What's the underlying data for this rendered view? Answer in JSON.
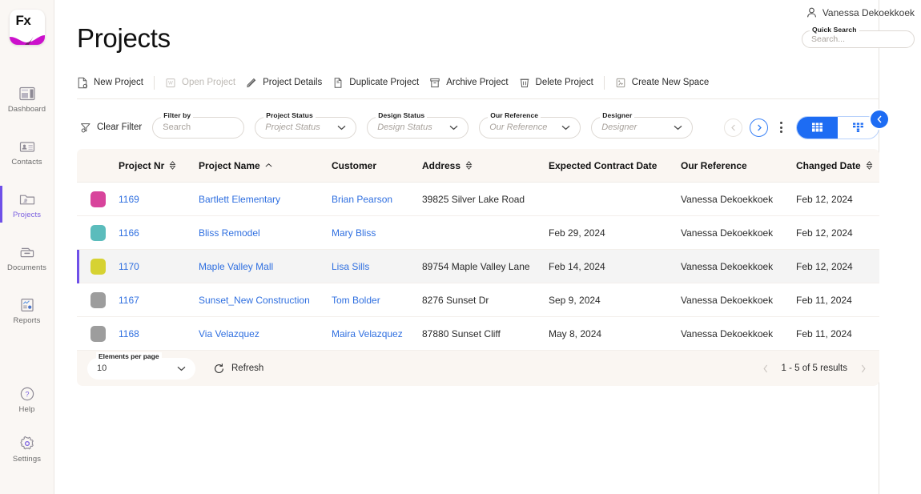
{
  "brand": {
    "logo_text": "Fx",
    "accent": "#6f50e8",
    "blue": "#1d6cf3"
  },
  "sidebar": {
    "items": [
      {
        "label": "Dashboard",
        "icon": "dashboard-icon",
        "active": false
      },
      {
        "label": "Contacts",
        "icon": "contacts-icon",
        "active": false
      },
      {
        "label": "Projects",
        "icon": "projects-folder-icon",
        "active": true
      },
      {
        "label": "Documents",
        "icon": "documents-icon",
        "active": false
      },
      {
        "label": "Reports",
        "icon": "reports-icon",
        "active": false
      }
    ],
    "bottom_items": [
      {
        "label": "Help",
        "icon": "help-circle-icon"
      },
      {
        "label": "Settings",
        "icon": "gear-icon"
      }
    ]
  },
  "header": {
    "title": "Projects",
    "user_name": "Vanessa Dekoekkoek",
    "quick_search": {
      "label": "Quick Search",
      "placeholder": "Search..."
    }
  },
  "toolbar": {
    "items": [
      {
        "label": "New Project",
        "icon": "new-document-icon",
        "disabled": false
      },
      {
        "label": "Open Project",
        "icon": "open-window-icon",
        "disabled": true
      },
      {
        "label": "Project Details",
        "icon": "pencil-icon",
        "disabled": false
      },
      {
        "label": "Duplicate Project",
        "icon": "duplicate-icon",
        "disabled": false
      },
      {
        "label": "Archive Project",
        "icon": "archive-box-icon",
        "disabled": false
      },
      {
        "label": "Delete Project",
        "icon": "trash-icon",
        "disabled": false
      },
      {
        "label": "Create New Space",
        "icon": "create-space-icon",
        "disabled": false
      }
    ]
  },
  "filters": {
    "clear_label": "Clear Filter",
    "fields": [
      {
        "label": "Filter by",
        "value": "Search",
        "type": "search"
      },
      {
        "label": "Project Status",
        "value": "Project Status",
        "type": "select"
      },
      {
        "label": "Design Status",
        "value": "Design Status",
        "type": "select"
      },
      {
        "label": "Our Reference",
        "value": "Our Reference",
        "type": "select"
      },
      {
        "label": "Designer",
        "value": "Designer",
        "type": "select"
      }
    ],
    "view_modes": [
      {
        "name": "grid-view",
        "selected": true
      },
      {
        "name": "column-view",
        "selected": false
      }
    ]
  },
  "table": {
    "columns": [
      {
        "label": "",
        "sort": "none"
      },
      {
        "label": "Project Nr",
        "sort": "both"
      },
      {
        "label": "Project Name",
        "sort": "asc"
      },
      {
        "label": "Customer",
        "sort": "none"
      },
      {
        "label": "Address",
        "sort": "both"
      },
      {
        "label": "Expected Contract Date",
        "sort": "none"
      },
      {
        "label": "Our Reference",
        "sort": "none"
      },
      {
        "label": "Changed Date",
        "sort": "both"
      }
    ],
    "rows": [
      {
        "color": "#d8449c",
        "nr": "1169",
        "name": "Bartlett Elementary",
        "customer": "Brian Pearson",
        "address": "39825 Silver Lake Road",
        "expected": "",
        "reference": "Vanessa Dekoekkoek",
        "changed": "Feb 12, 2024",
        "selected": false
      },
      {
        "color": "#5bbcbc",
        "nr": "1166",
        "name": "Bliss Remodel",
        "customer": "Mary Bliss",
        "address": "",
        "expected": "Feb 29, 2024",
        "reference": "Vanessa Dekoekkoek",
        "changed": "Feb 12, 2024",
        "selected": false
      },
      {
        "color": "#d6d232",
        "nr": "1170",
        "name": "Maple Valley Mall",
        "customer": "Lisa Sills",
        "address": "89754 Maple Valley Lane",
        "expected": "Feb 14, 2024",
        "reference": "Vanessa Dekoekkoek",
        "changed": "Feb 12, 2024",
        "selected": true
      },
      {
        "color": "#9d9d9d",
        "nr": "1167",
        "name": "Sunset_New Construction",
        "customer": "Tom Bolder",
        "address": "8276 Sunset Dr",
        "expected": "Sep 9, 2024",
        "reference": "Vanessa Dekoekkoek",
        "changed": "Feb 11, 2024",
        "selected": false
      },
      {
        "color": "#9d9d9d",
        "nr": "1168",
        "name": "Via Velazquez",
        "customer": "Maira Velazquez",
        "address": "87880 Sunset Cliff",
        "expected": "May 8, 2024",
        "reference": "Vanessa Dekoekkoek",
        "changed": "Feb 11, 2024",
        "selected": false
      }
    ]
  },
  "footer": {
    "elements_per_page_label": "Elements per page",
    "elements_per_page_value": "10",
    "refresh_label": "Refresh",
    "results_text": "1 - 5 of 5 results"
  }
}
